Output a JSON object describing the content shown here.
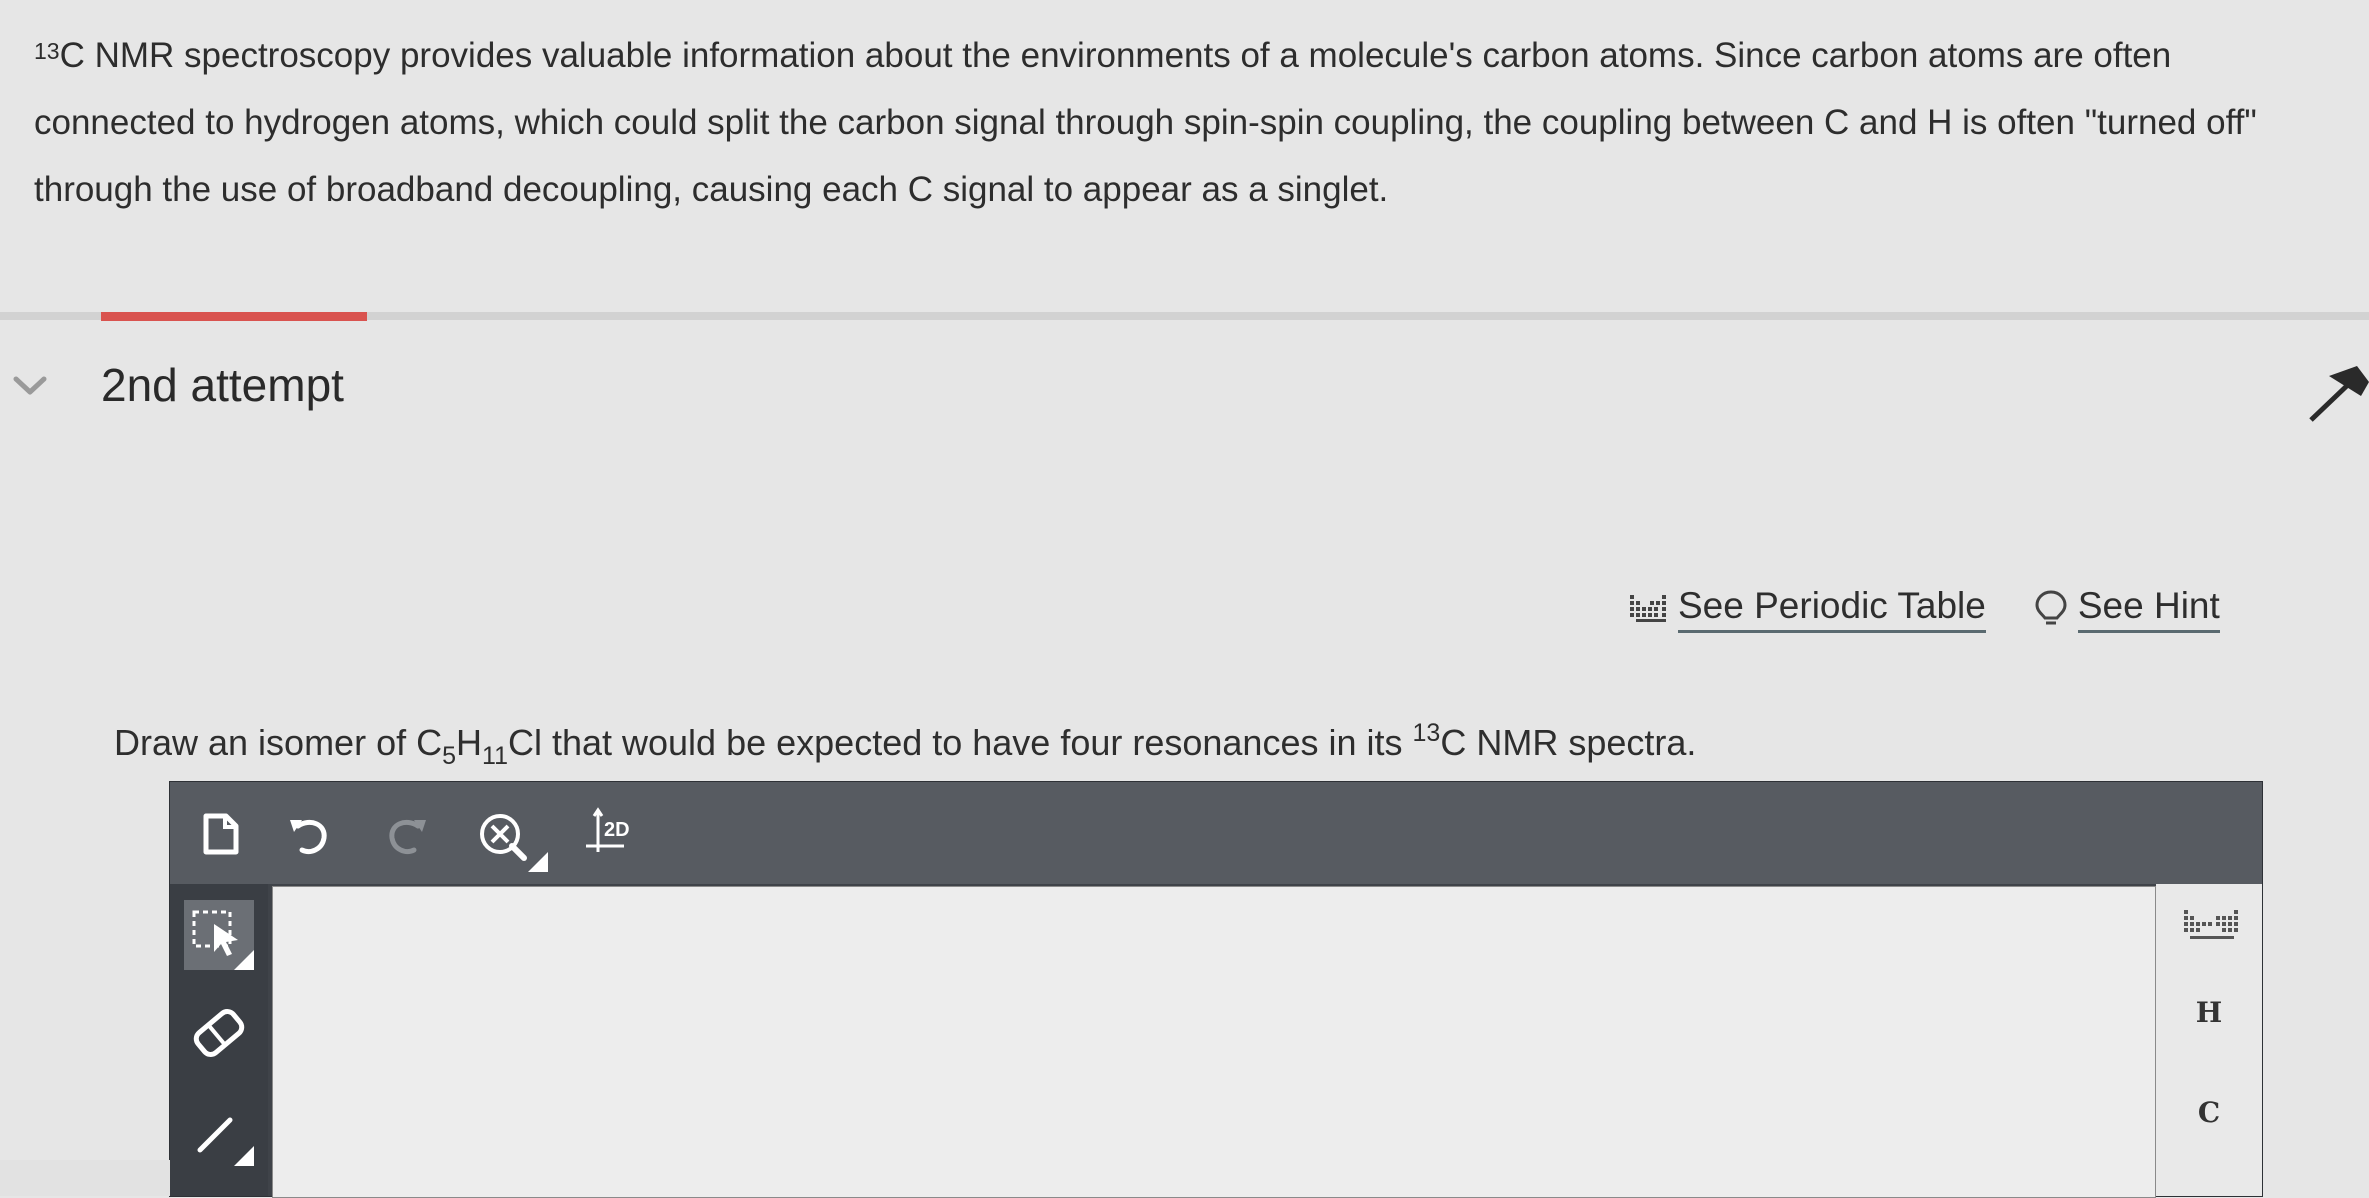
{
  "intro": {
    "sup": "13",
    "text": "C NMR spectroscopy provides valuable information about the environments of a molecule's carbon atoms. Since carbon atoms are often connected to hydrogen atoms, which could split the carbon signal through spin-spin coupling, the coupling between C and H is often \"turned off\" through the use of broadband decoupling, causing each C signal to appear as a singlet."
  },
  "attempt": {
    "label": "2nd attempt"
  },
  "links": {
    "periodic_table": "See Periodic Table",
    "hint": "See Hint"
  },
  "prompt": {
    "p1": "Draw an isomer of C",
    "sub1": "5",
    "p2": "H",
    "sub2": "11",
    "p3": "Cl that would be expected to have four resonances in its ",
    "sup": "13",
    "p4": "C NMR spectra."
  },
  "toolbar": {
    "twod_label": "2D"
  },
  "elements": {
    "h": "H",
    "c": "C"
  },
  "colors": {
    "accent_red": "#d9534f",
    "toolbar_bg": "#575b61",
    "sidebar_bg": "#3a3e44"
  },
  "icons": [
    "chevron-down-icon",
    "periodic-table-icon",
    "lightbulb-icon",
    "new-document-icon",
    "undo-icon",
    "redo-icon",
    "zoom-clear-icon",
    "2d-cleanup-icon",
    "selection-tool-icon",
    "eraser-icon",
    "bond-tool-icon"
  ]
}
